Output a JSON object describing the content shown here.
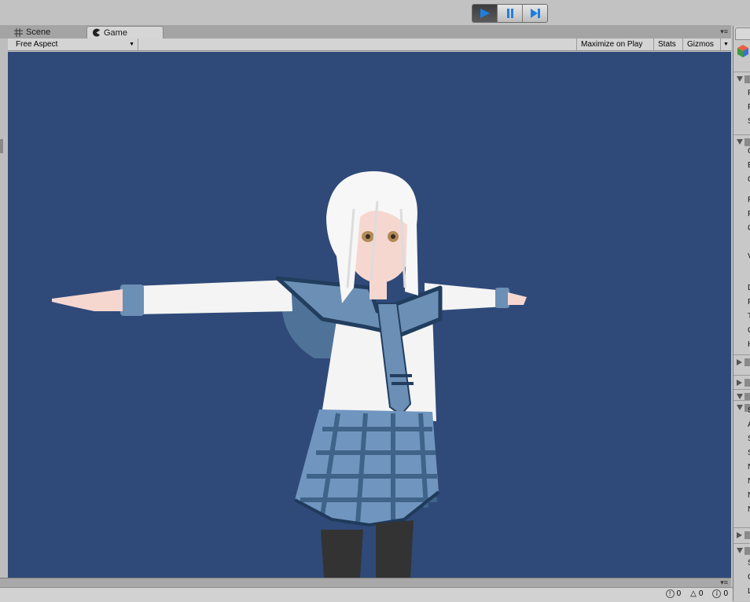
{
  "toolbar": {
    "play_icon": "play-icon",
    "pause_icon": "pause-icon",
    "step_icon": "step-icon",
    "accent": "#1f7fe0"
  },
  "tabs": {
    "scene_label": "Scene",
    "game_label": "Game",
    "scene_icon": "grid-icon",
    "game_icon": "pacman-icon"
  },
  "game_toolbar": {
    "aspect_value": "Free Aspect",
    "maximize_label": "Maximize on Play",
    "stats_label": "Stats",
    "gizmos_label": "Gizmos"
  },
  "viewport": {
    "background": "#2f4a79",
    "subject": "character-model"
  },
  "inspector_letters": [
    "F",
    "F",
    "S",
    "C",
    "E",
    "C",
    "F",
    "F",
    "C",
    "V",
    "D",
    "F",
    "T",
    "C",
    "H",
    "S",
    "A",
    "S",
    "S",
    "N",
    "N",
    "N",
    "N",
    "S",
    "C",
    "L"
  ],
  "status": {
    "errors": "0",
    "warnings": "0",
    "messages": "0"
  }
}
